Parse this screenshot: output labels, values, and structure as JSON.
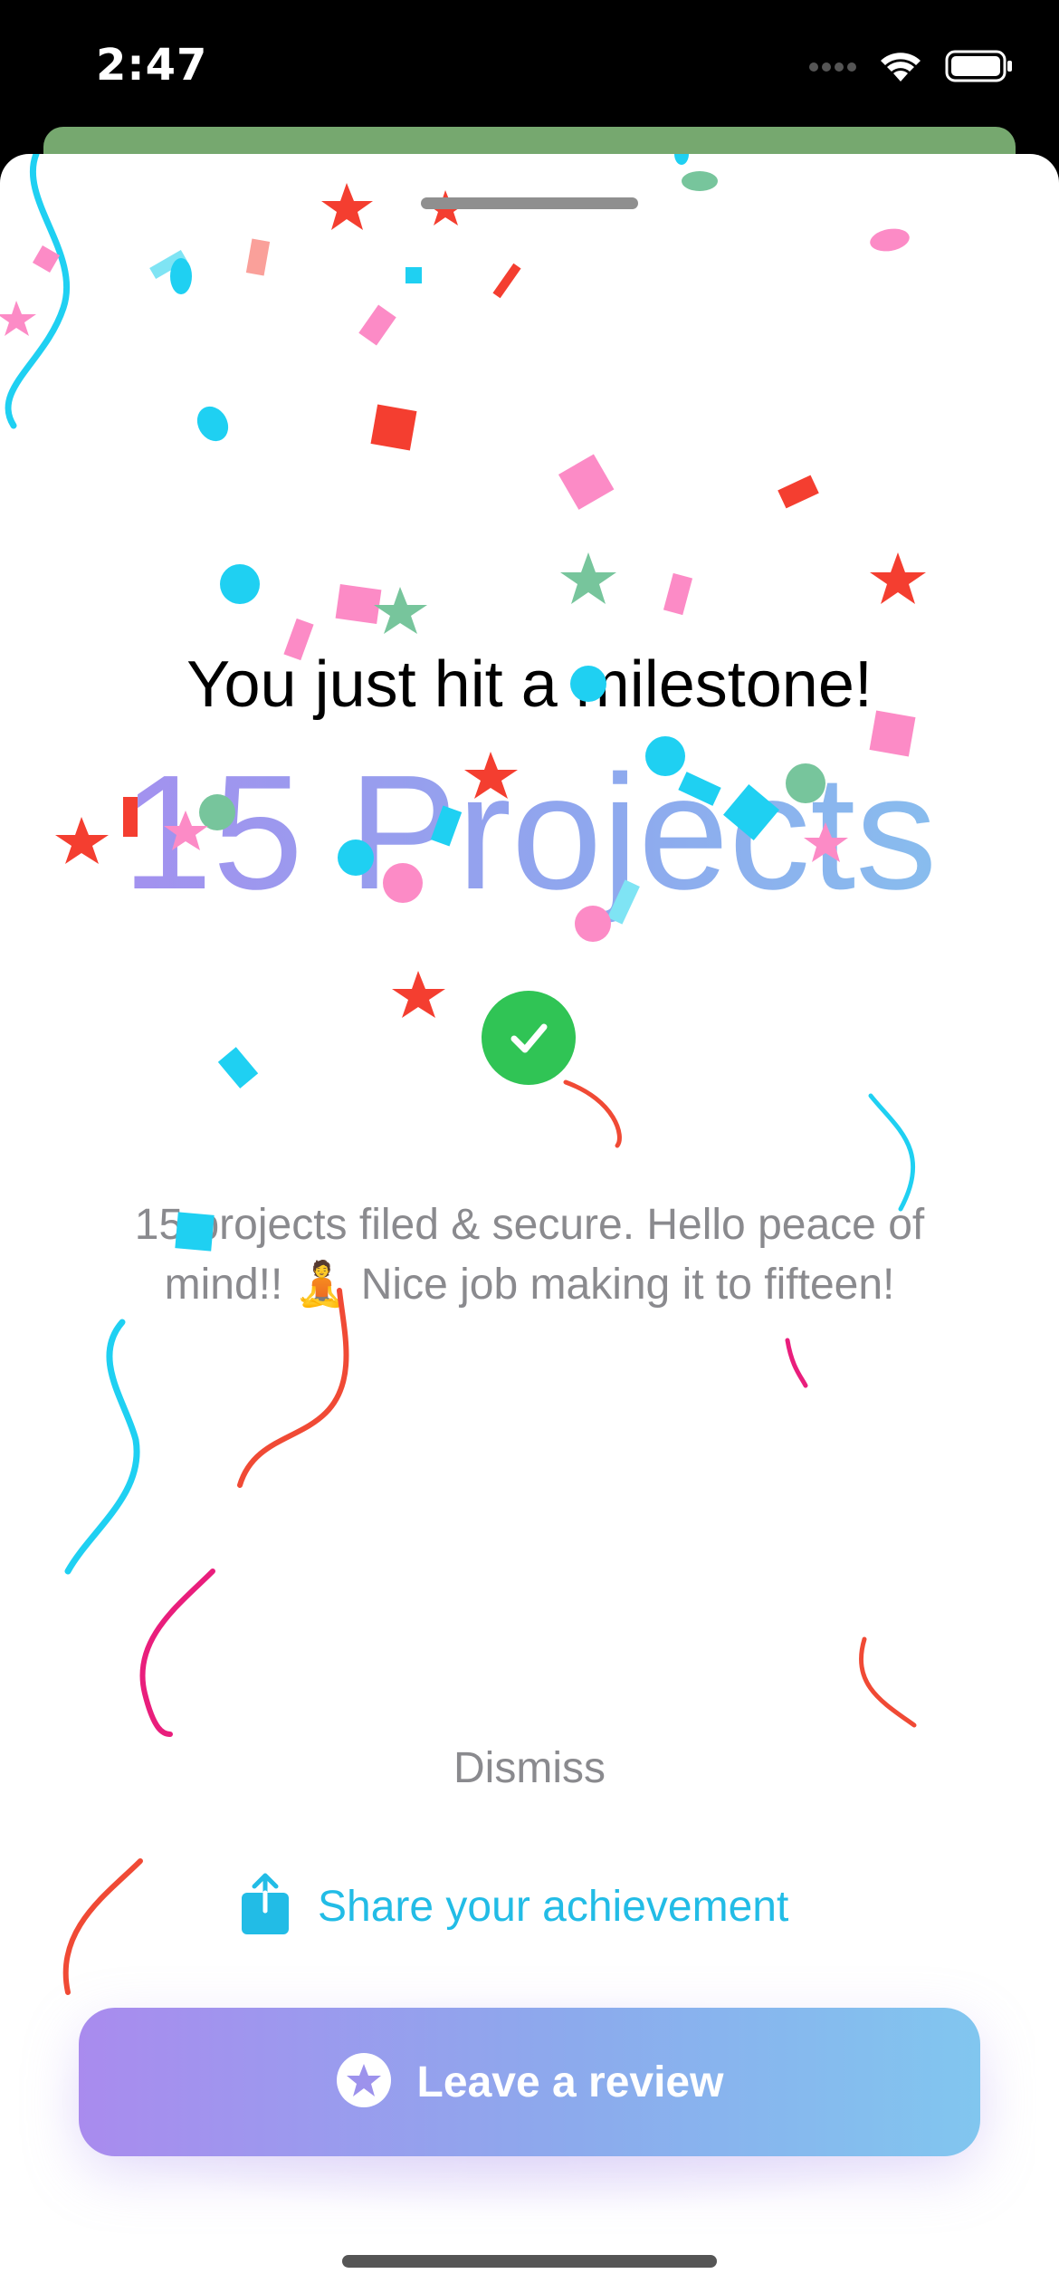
{
  "status_bar": {
    "time": "2:47",
    "icons": [
      "signal-dots-icon",
      "wifi-icon",
      "battery-icon"
    ]
  },
  "milestone": {
    "headline": "You just hit a milestone!",
    "count_label": "15 Projects",
    "check_icon": "checkmark-circle-icon",
    "description": "15 projects filed & secure. Hello peace of mind!! 🧘 Nice job making it to fifteen!"
  },
  "actions": {
    "dismiss_label": "Dismiss",
    "share_label": "Share your achievement",
    "share_icon": "share-icon",
    "review_label": "Leave a review",
    "review_icon": "star-circle-icon"
  },
  "colors": {
    "accent_share": "#22BCE6",
    "gradient_start": "#A98BEE",
    "gradient_end": "#81C6EF",
    "check_green": "#30C455"
  }
}
